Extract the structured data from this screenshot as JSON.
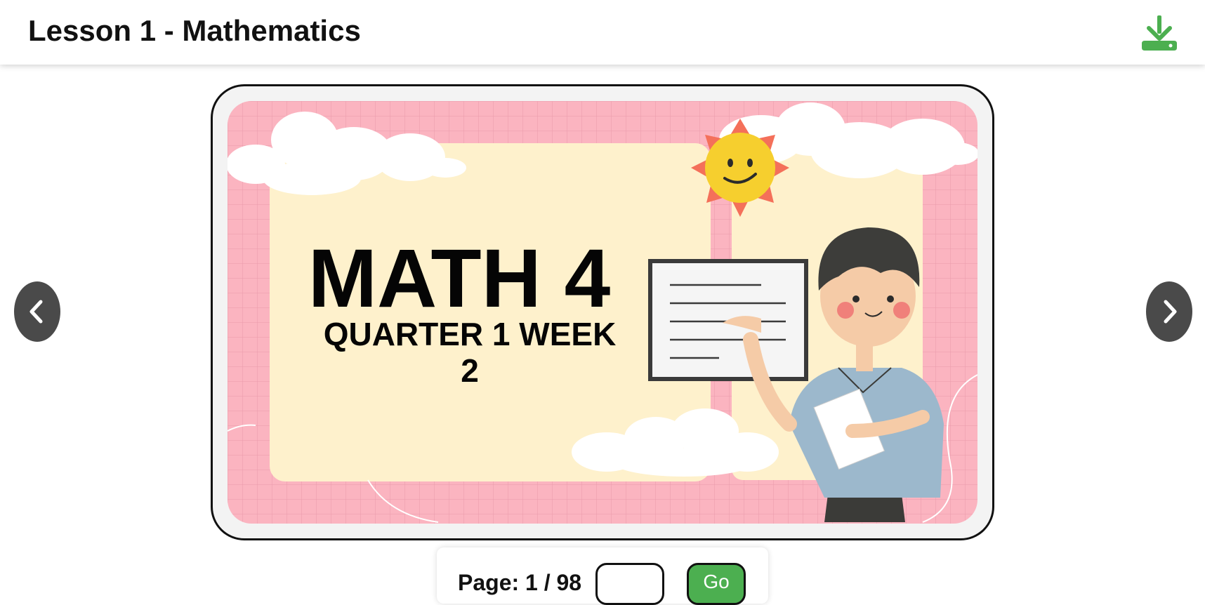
{
  "header": {
    "title": "Lesson 1 - Mathematics",
    "download_icon": "download-icon",
    "accent_color": "#4caf50"
  },
  "viewer": {
    "slide": {
      "title": "MATH 4",
      "subtitle_line1": "QUARTER 1 WEEK",
      "subtitle_line2": "2"
    },
    "prev_icon": "chevron-left-icon",
    "next_icon": "chevron-right-icon"
  },
  "pager": {
    "label": "Page: 1 / 98",
    "input_value": "",
    "go_label": "Go",
    "current_page": 1,
    "total_pages": 98
  }
}
